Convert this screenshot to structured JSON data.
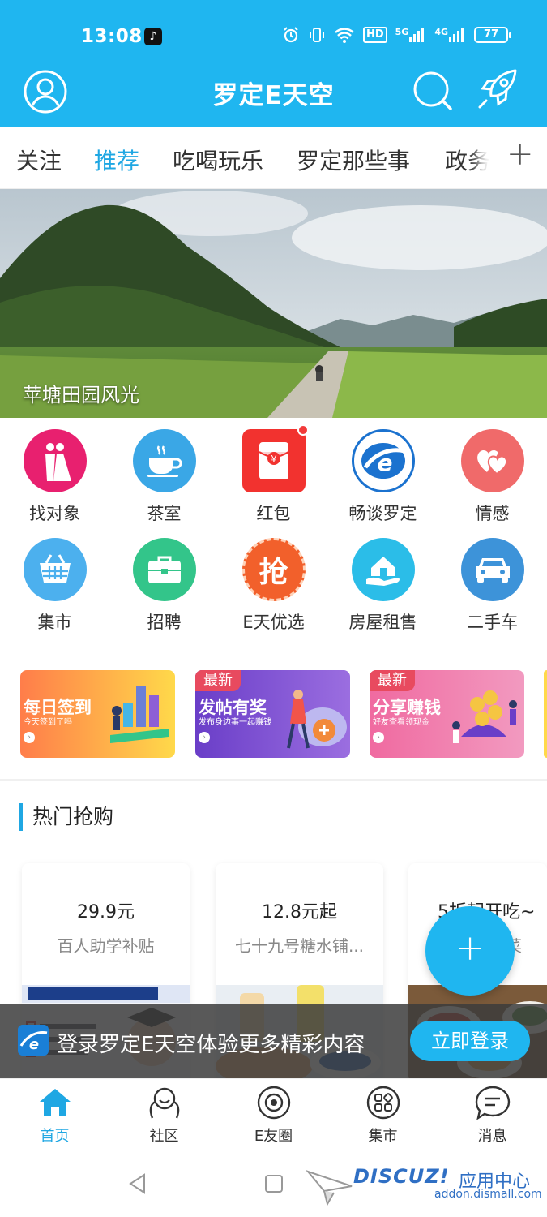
{
  "status_bar": {
    "time": "13:08",
    "hd": "HD",
    "net1": "5G",
    "net2": "4G",
    "battery": "77"
  },
  "header": {
    "title": "罗定E天空"
  },
  "tabs": [
    {
      "label": "关注"
    },
    {
      "label": "推荐",
      "active": true
    },
    {
      "label": "吃喝玩乐"
    },
    {
      "label": "罗定那些事"
    },
    {
      "label": "政务服"
    }
  ],
  "banner": {
    "caption": "苹塘田园风光"
  },
  "features": [
    {
      "label": "找对象",
      "icon": "wedding-couple-icon",
      "color": "#e8206f"
    },
    {
      "label": "茶室",
      "icon": "tea-cup-icon",
      "color": "#3aa7e6"
    },
    {
      "label": "红包",
      "icon": "red-envelope-icon",
      "color": "#f2322f"
    },
    {
      "label": "畅谈罗定",
      "icon": "e-logo-icon",
      "color": "#1b72cf"
    },
    {
      "label": "情感",
      "icon": "hearts-icon",
      "color": "#f06a6a"
    },
    {
      "label": "集市",
      "icon": "basket-icon",
      "color": "#4cb0ee"
    },
    {
      "label": "招聘",
      "icon": "briefcase-icon",
      "color": "#33c58a"
    },
    {
      "label": "E天优选",
      "icon": "grab-badge-icon",
      "color": "#f2602b",
      "glyph": "抢"
    },
    {
      "label": "房屋租售",
      "icon": "house-hand-icon",
      "color": "#2bbde8"
    },
    {
      "label": "二手车",
      "icon": "car-icon",
      "color": "#3d93d9"
    }
  ],
  "promos": [
    {
      "title": "每日签到",
      "subtitle": "今天签到了吗",
      "badge": ""
    },
    {
      "title": "发帖有奖",
      "subtitle": "发布身边事一起赚钱",
      "badge": "最新"
    },
    {
      "title": "分享赚钱",
      "subtitle": "好友查看领现金",
      "badge": "最新"
    }
  ],
  "hot_section": {
    "title": "热门抢购"
  },
  "hot_items": [
    {
      "price": "29.9元",
      "name": "百人助学补贴"
    },
    {
      "price": "12.8元起",
      "name": "七十九号糖水铺..."
    },
    {
      "price": "5折起开吃~",
      "name": "特色私房菜"
    }
  ],
  "fab": {
    "label": "+"
  },
  "login_bar": {
    "text": "登录罗定E天空体验更多精彩内容",
    "button": "立即登录"
  },
  "bottom_nav": [
    {
      "label": "首页",
      "active": true
    },
    {
      "label": "社区"
    },
    {
      "label": "E友圈"
    },
    {
      "label": "集市"
    },
    {
      "label": "消息"
    }
  ],
  "watermark": {
    "main": "DISCUZ!",
    "cn": "应用中心",
    "sub": "addon.dismall.com"
  },
  "colors": {
    "primary": "#1fb6f0",
    "accent": "#1fa7e3"
  }
}
